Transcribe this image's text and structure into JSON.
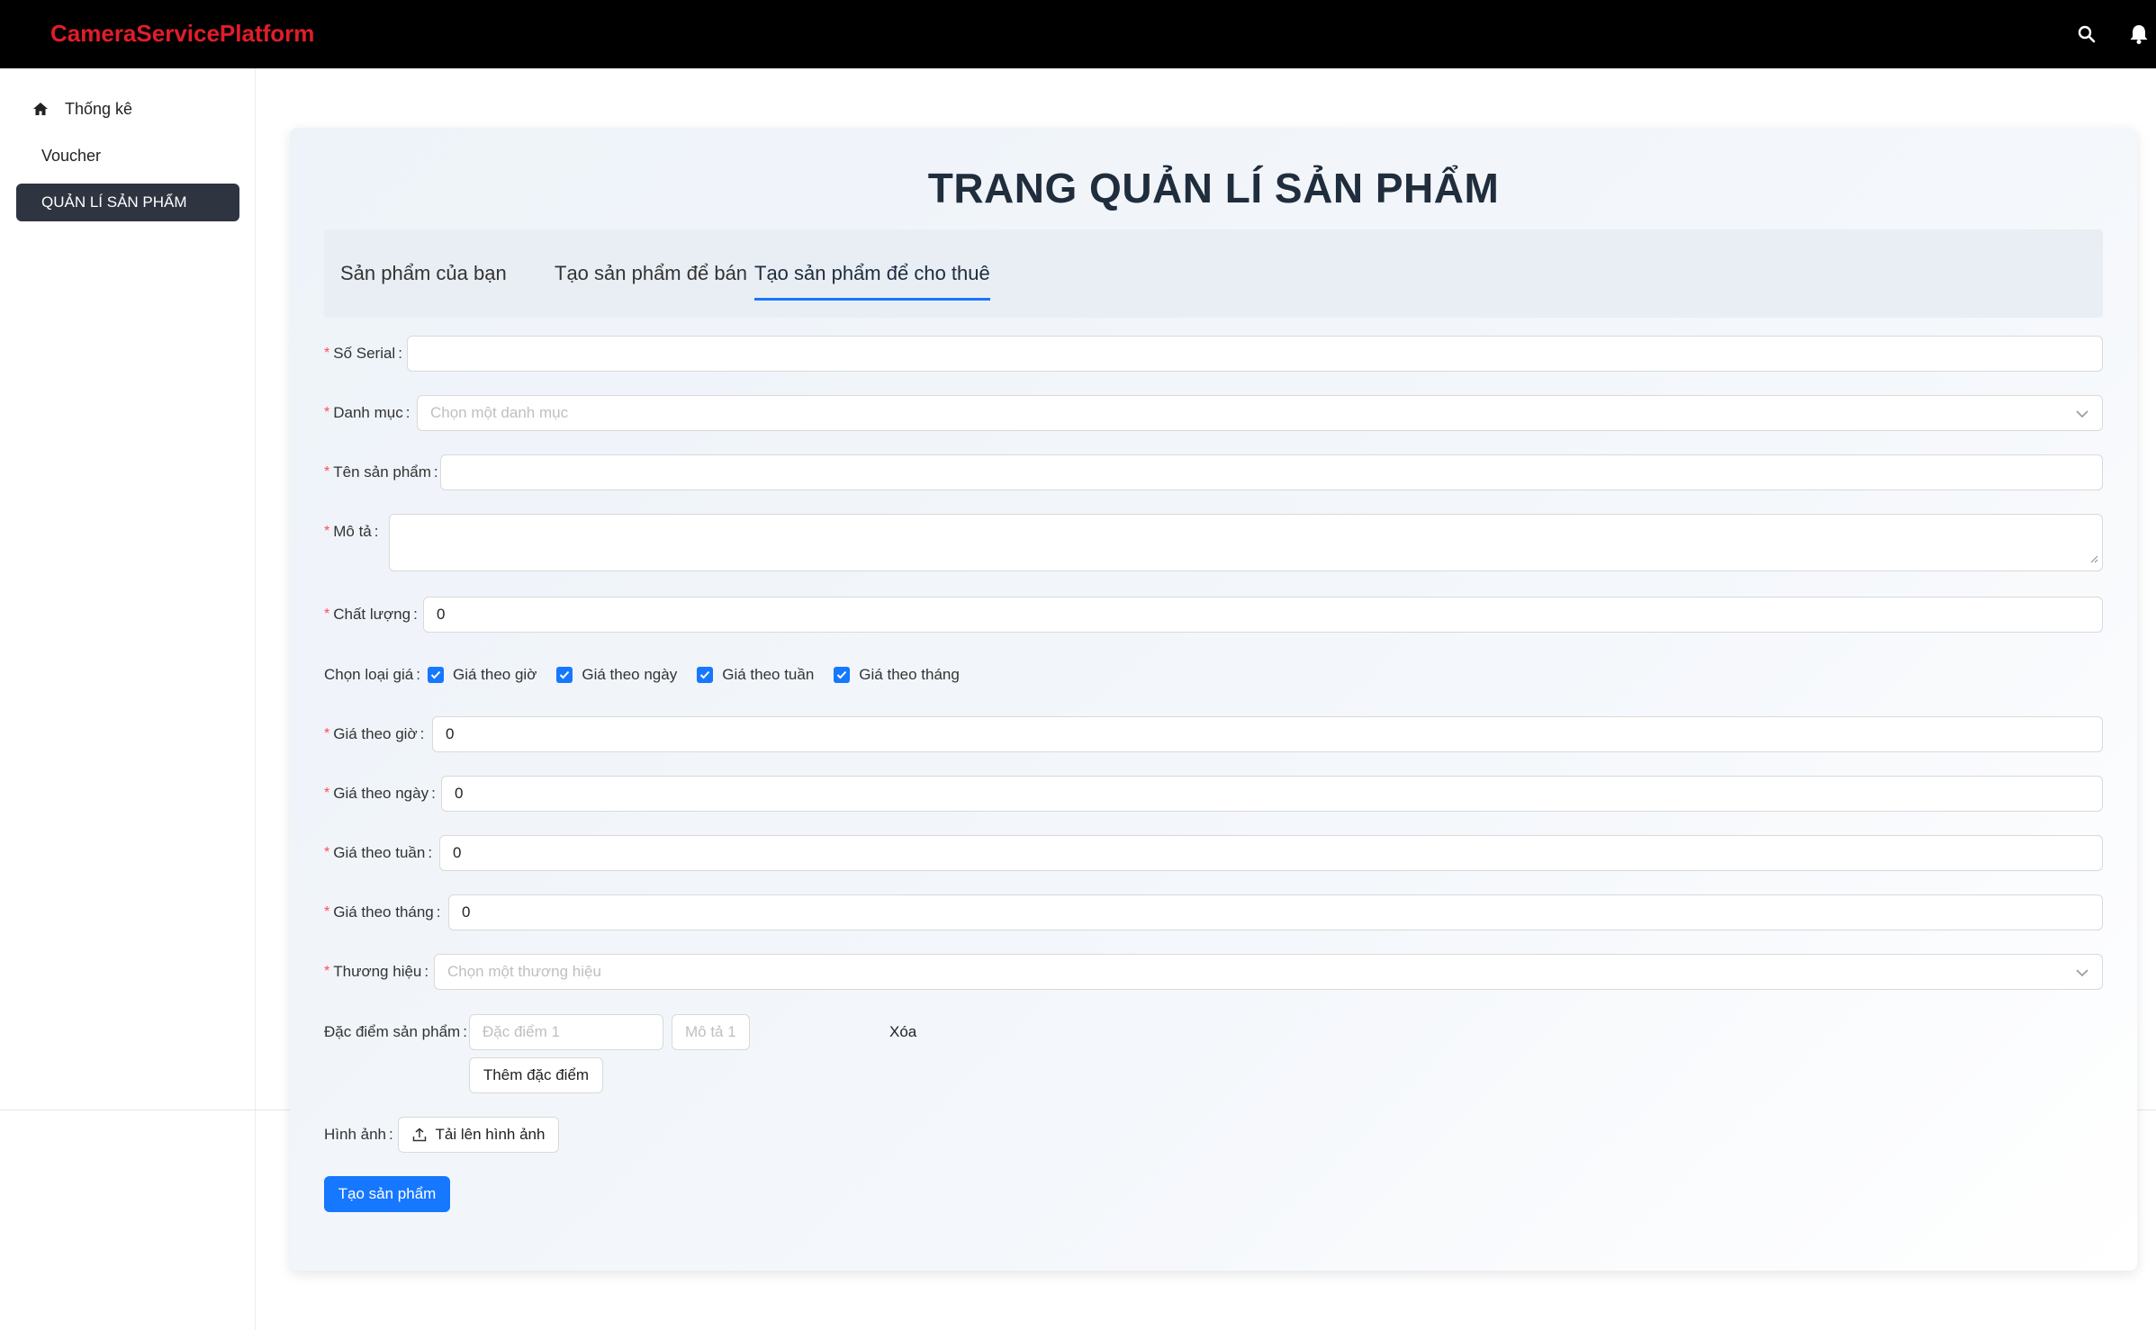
{
  "app": {
    "brand": "CameraServicePlatform"
  },
  "sidebar": {
    "items": [
      {
        "label": "Thống kê",
        "icon": "home-icon"
      },
      {
        "label": "Voucher"
      },
      {
        "label": "QUẢN LÍ SẢN PHẨM",
        "active": true
      }
    ]
  },
  "page": {
    "title": "TRANG QUẢN LÍ SẢN PHẨM"
  },
  "tabs": [
    {
      "label": "Sản phẩm của bạn"
    },
    {
      "label": "Tạo sản phẩm để bán"
    },
    {
      "label": "Tạo sản phẩm để cho thuê",
      "active": true
    }
  ],
  "form": {
    "serial": {
      "label": "Số Serial",
      "value": ""
    },
    "category": {
      "label": "Danh mục",
      "placeholder": "Chọn một danh mục"
    },
    "name": {
      "label": "Tên sản phẩm",
      "value": ""
    },
    "description": {
      "label": "Mô tả",
      "value": ""
    },
    "quality": {
      "label": "Chất lượng",
      "value": "0"
    },
    "price_type": {
      "label": "Chọn loại giá",
      "options": [
        {
          "label": "Giá theo giờ",
          "checked": true
        },
        {
          "label": "Giá theo ngày",
          "checked": true
        },
        {
          "label": "Giá theo tuần",
          "checked": true
        },
        {
          "label": "Giá theo tháng",
          "checked": true
        }
      ]
    },
    "price_hour": {
      "label": "Giá theo giờ",
      "value": "0"
    },
    "price_day": {
      "label": "Giá theo ngày",
      "value": "0"
    },
    "price_week": {
      "label": "Giá theo tuần",
      "value": "0"
    },
    "price_month": {
      "label": "Giá theo tháng",
      "value": "0"
    },
    "brand": {
      "label": "Thương hiệu",
      "placeholder": "Chọn một thương hiệu"
    },
    "features": {
      "label": "Đặc điểm sản phẩm",
      "feature_placeholder": "Đặc điểm 1",
      "desc_placeholder": "Mô tả 1",
      "remove_label": "Xóa",
      "add_label": "Thêm đặc điểm"
    },
    "image": {
      "label": "Hình ảnh",
      "upload_label": "Tải lên hình ảnh"
    },
    "submit_label": "Tạo sản phẩm"
  },
  "colors": {
    "primary": "#1677ff",
    "brand": "#e11d2a",
    "topbar": "#000000",
    "sidebar_active": "#2e3440",
    "required": "#ff4d4f"
  }
}
